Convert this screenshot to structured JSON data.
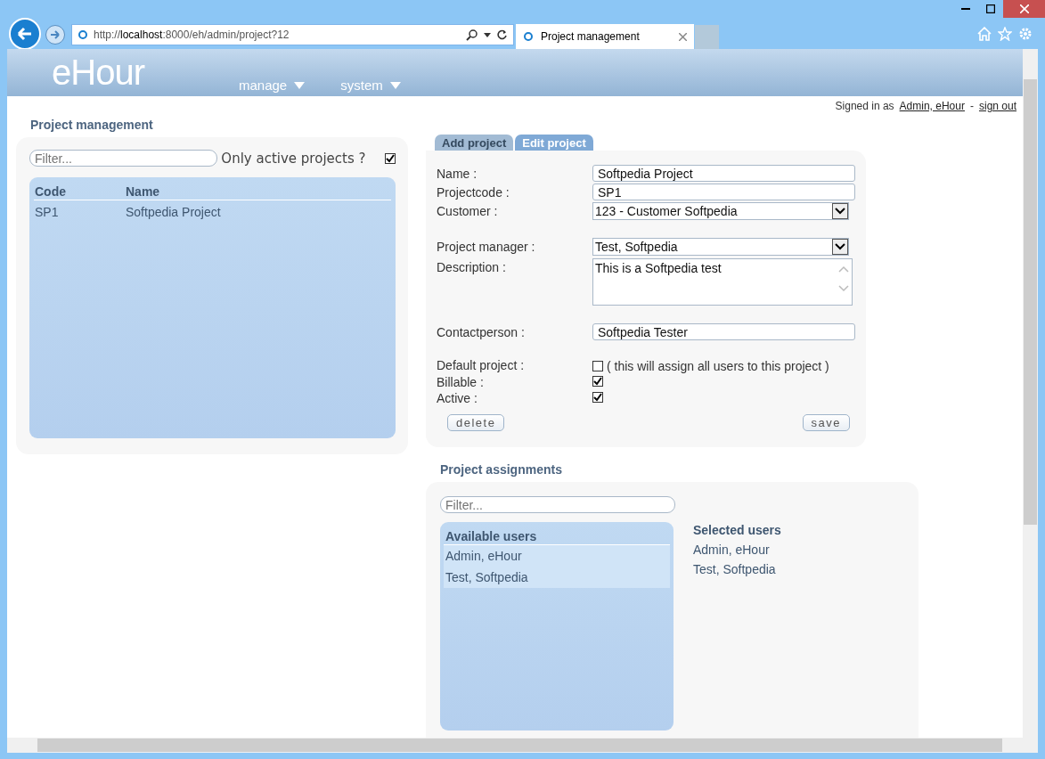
{
  "browser": {
    "address_prefix": "http://",
    "address_host": "localhost",
    "address_rest": ":8000/eh/admin/project?12",
    "tab_title": "Project management"
  },
  "header": {
    "logo": "eHour",
    "menu": [
      {
        "label": "manage"
      },
      {
        "label": "system"
      }
    ]
  },
  "user_bar": {
    "prefix": "Signed in as",
    "user": "Admin, eHour",
    "separator": "-",
    "sign_out": "sign out"
  },
  "project_list": {
    "title": "Project management",
    "filter_placeholder": "Filter...",
    "only_active_label": "Only active projects ?",
    "only_active_checked": true,
    "columns": [
      "Code",
      "Name"
    ],
    "rows": [
      {
        "code": "SP1",
        "name": "Softpedia Project"
      }
    ]
  },
  "project_form": {
    "tabs": [
      {
        "label": "Add project",
        "selected": false
      },
      {
        "label": "Edit project",
        "selected": true
      }
    ],
    "fields": [
      {
        "kind": "text",
        "label": "Name :",
        "value": "Softpedia Project"
      },
      {
        "kind": "text",
        "label": "Projectcode :",
        "value": "SP1"
      },
      {
        "kind": "select",
        "label": "Customer :",
        "value": "123 - Customer Softpedia"
      },
      {
        "kind": "select",
        "label": "Project manager :",
        "value": "Test, Softpedia"
      },
      {
        "kind": "textarea",
        "label": "Description :",
        "value": "This is a Softpedia test"
      },
      {
        "kind": "text",
        "label": "Contactperson :",
        "value": "Softpedia Tester"
      },
      {
        "kind": "checkbox",
        "label": "Default project :",
        "checked": false,
        "note": "( this will assign all users to this project )"
      },
      {
        "kind": "checkbox",
        "label": "Billable :",
        "checked": true
      },
      {
        "kind": "checkbox",
        "label": "Active :",
        "checked": true
      }
    ],
    "buttons": [
      "delete",
      "save"
    ]
  },
  "assignments": {
    "title": "Project assignments",
    "filter_placeholder": "Filter...",
    "available_title": "Available users",
    "available": [
      "Admin, eHour",
      "Test, Softpedia"
    ],
    "selected_title": "Selected users",
    "selected": [
      "Admin, eHour",
      "Test, Softpedia"
    ]
  }
}
